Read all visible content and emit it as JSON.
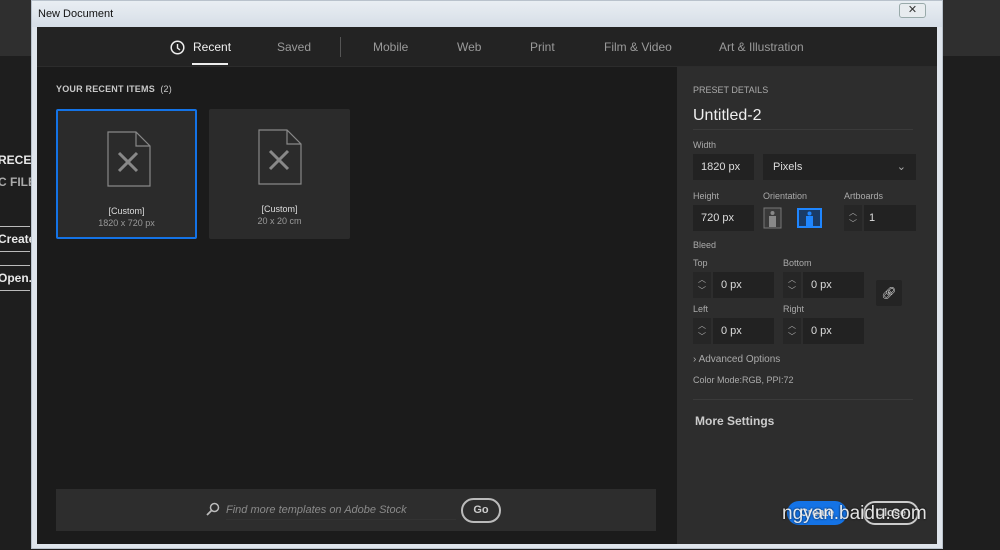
{
  "background_app": {
    "recent": "RECENT",
    "files": "C FILE",
    "create": "Create",
    "open": "Open."
  },
  "window": {
    "title": "New Document",
    "close": "✕"
  },
  "tabs": [
    {
      "label": "Recent",
      "icon": "clock-icon",
      "active": true
    },
    {
      "label": "Saved"
    },
    {
      "label": "Mobile"
    },
    {
      "label": "Web"
    },
    {
      "label": "Print"
    },
    {
      "label": "Film & Video"
    },
    {
      "label": "Art & Illustration"
    }
  ],
  "recent": {
    "heading": "YOUR RECENT ITEMS",
    "count": "(2)",
    "items": [
      {
        "name": "[Custom]",
        "size": "1820 x 720 px",
        "selected": true
      },
      {
        "name": "[Custom]",
        "size": "20 x 20 cm"
      }
    ]
  },
  "search": {
    "placeholder": "Find more templates on Adobe Stock",
    "go": "Go"
  },
  "preset": {
    "heading": "PRESET DETAILS",
    "name": "Untitled-2",
    "width_label": "Width",
    "width": "1820 px",
    "unit": "Pixels",
    "height_label": "Height",
    "height": "720 px",
    "orientation_label": "Orientation",
    "orientation": "landscape",
    "artboards_label": "Artboards",
    "artboards": "1",
    "bleed_label": "Bleed",
    "top_label": "Top",
    "top": "0 px",
    "bottom_label": "Bottom",
    "bottom": "0 px",
    "left_label": "Left",
    "left": "0 px",
    "right_label": "Right",
    "right": "0 px",
    "advanced": "Advanced Options",
    "color_mode": "Color Mode:RGB, PPI:72",
    "more_settings": "More Settings",
    "create": "Create",
    "close": "Close"
  },
  "colors": {
    "accent": "#1473e6"
  },
  "watermark": "ngyan.baidu.com"
}
